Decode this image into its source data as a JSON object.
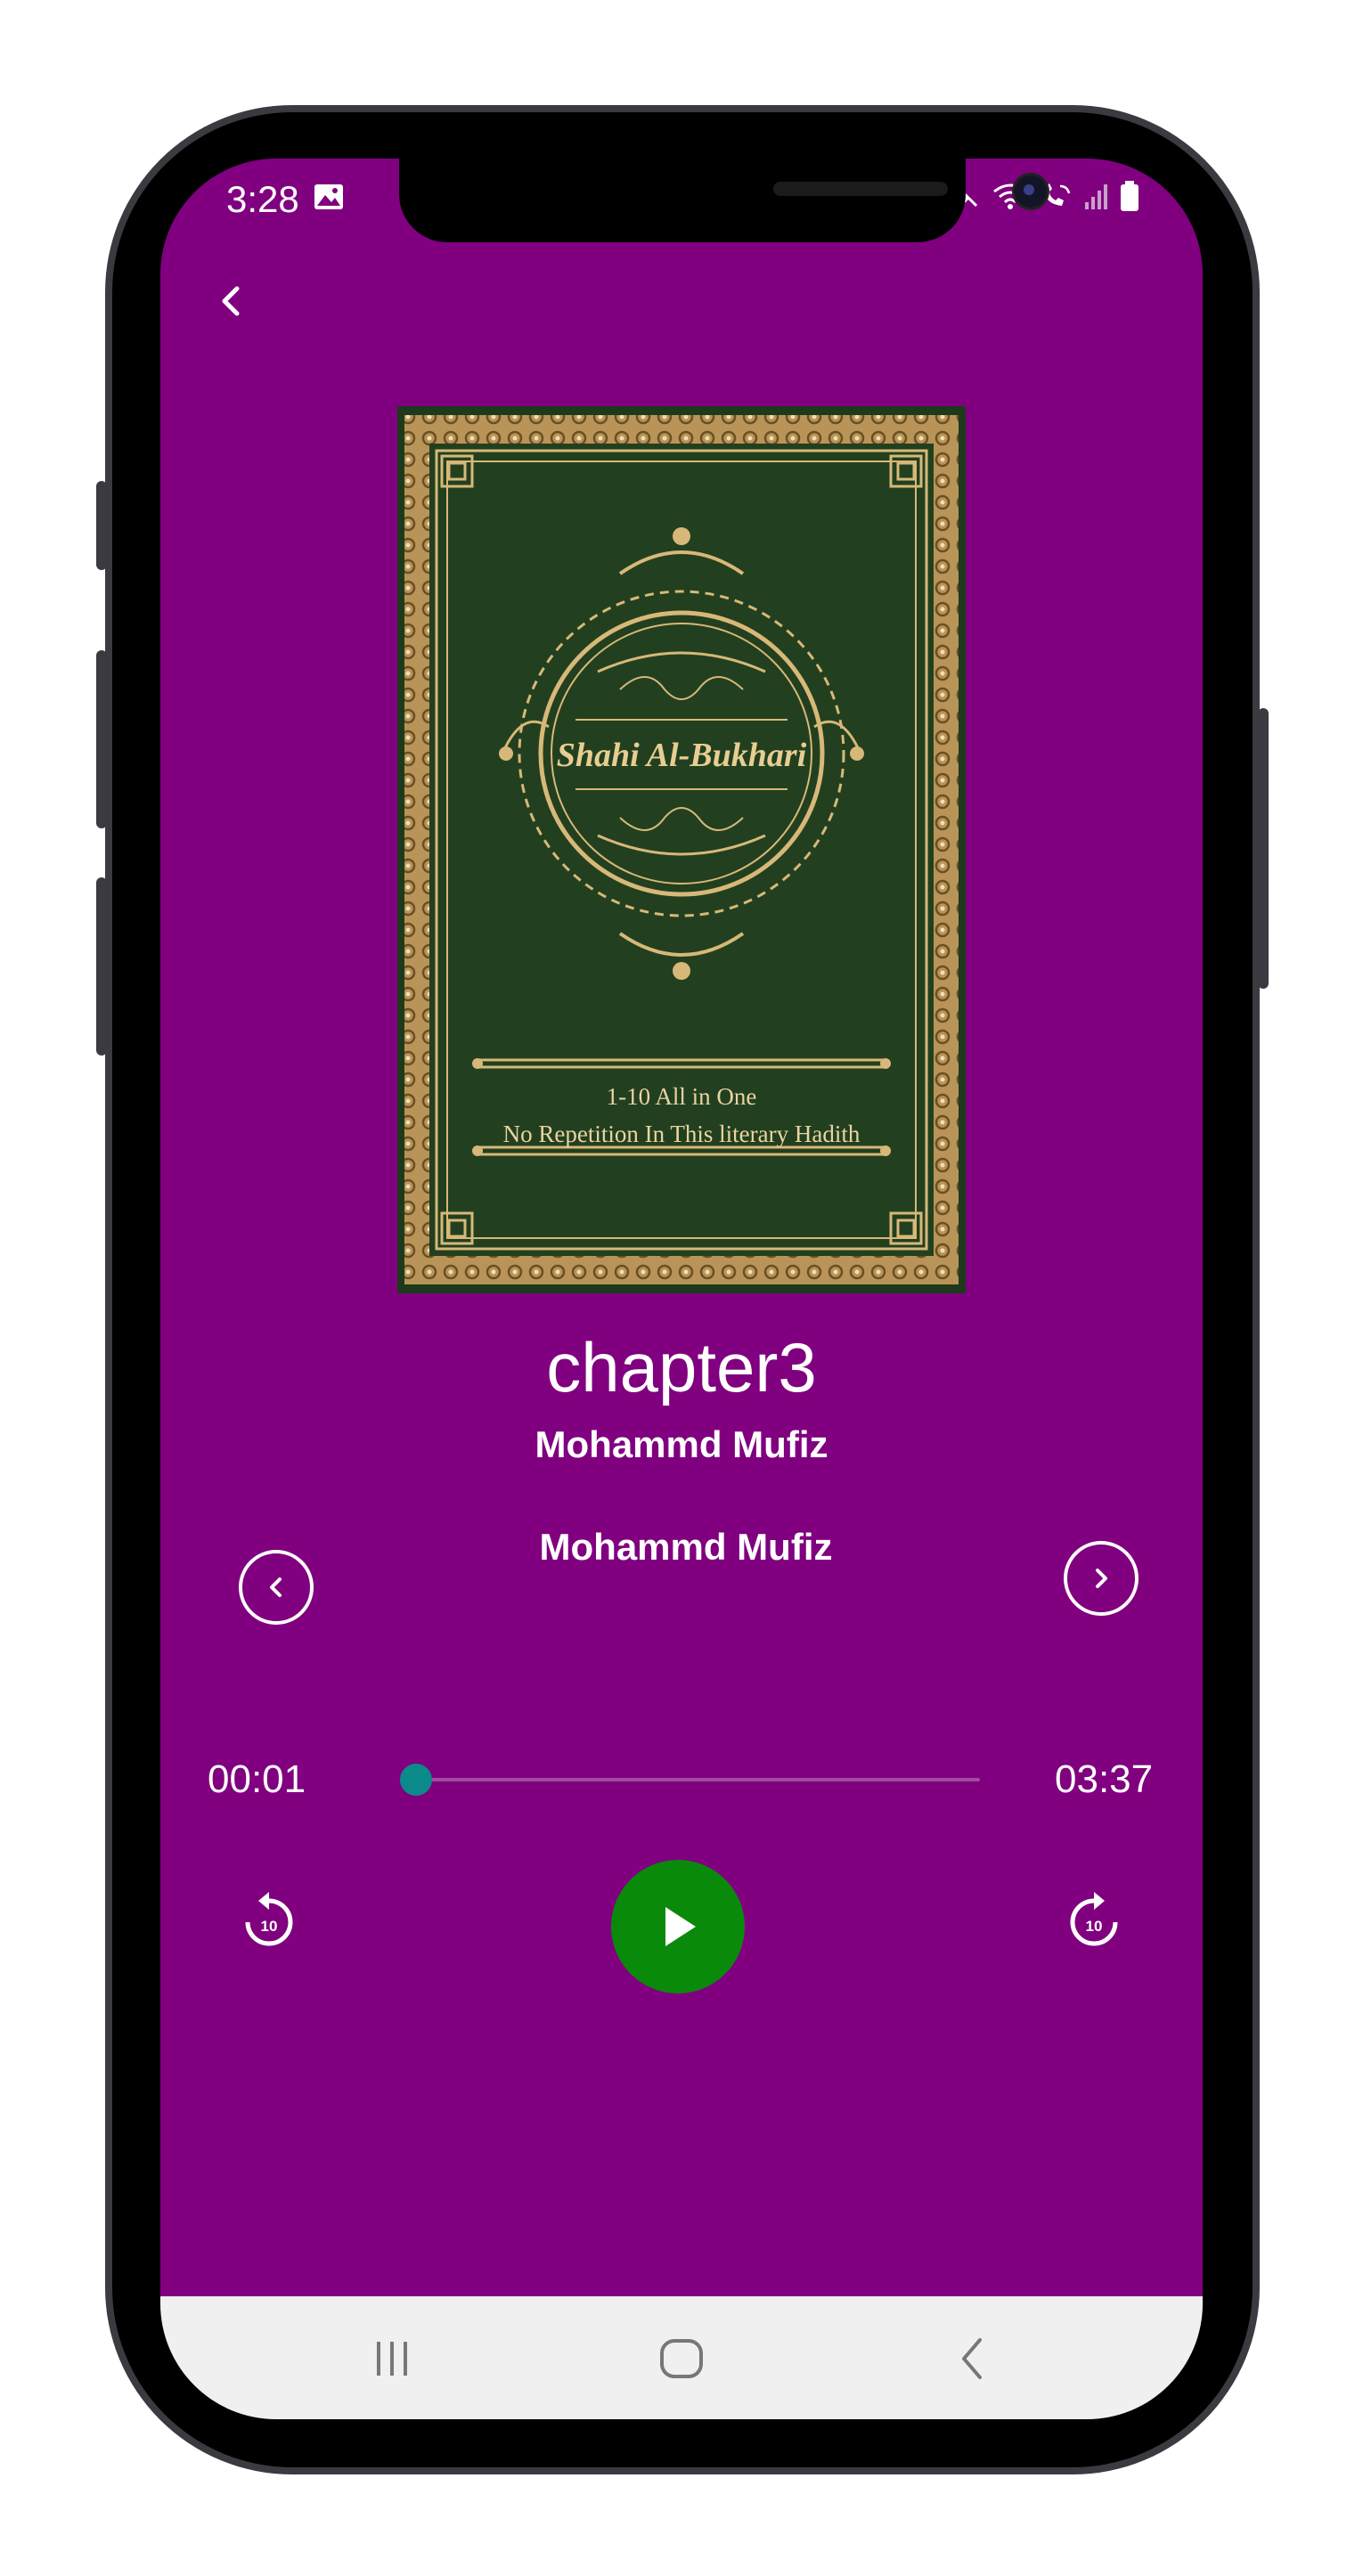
{
  "status_bar": {
    "time": "3:28"
  },
  "cover": {
    "title": "Shahi Al-Bukhari",
    "line1": "1-10 All in One",
    "line2": "No Repetition In This literary Hadith"
  },
  "track": {
    "title": "chapter3",
    "author": "Mohammd Mufiz",
    "narrator": "Mohammd Mufiz"
  },
  "player": {
    "elapsed": "00:01",
    "duration": "03:37",
    "progress": 0.005,
    "rewind_seconds": "10",
    "forward_seconds": "10"
  },
  "colors": {
    "background": "#800080",
    "play_button": "#0a8a0a",
    "seek_thumb": "#0a8a8a",
    "cover_green": "#1f3a1e",
    "cover_gold": "#d8b878"
  },
  "icons": [
    "back-arrow-icon",
    "previous-chapter-icon",
    "next-chapter-icon",
    "rewind-10-icon",
    "play-icon",
    "forward-10-icon",
    "recent-apps-icon",
    "home-icon",
    "nav-back-icon"
  ]
}
